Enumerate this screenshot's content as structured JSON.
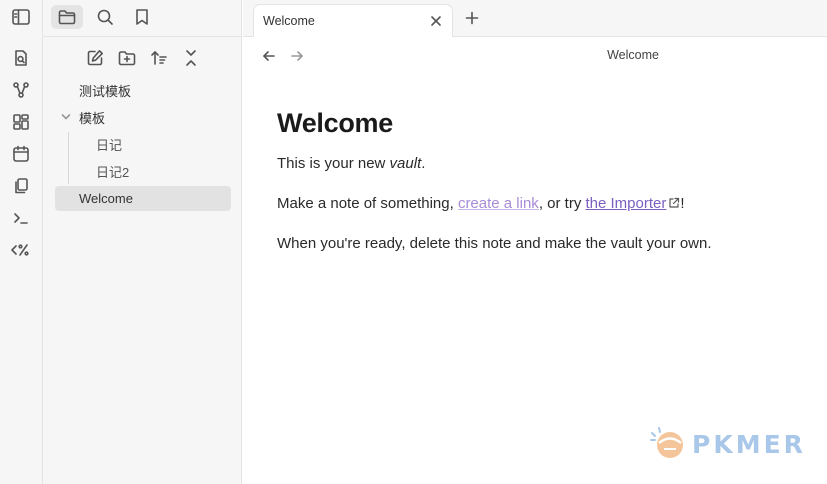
{
  "colors": {
    "ribbon_bg": "#f6f6f6",
    "active_tab_bg": "#e4e4e4",
    "link_internal": "#a88bd6",
    "link_external": "#7a5fc0",
    "watermark": "#a9c7e8"
  },
  "ribbon": {
    "icons": [
      "sidebar-toggle-icon",
      "quick-switcher-icon",
      "graph-view-icon",
      "canvas-icon",
      "daily-note-icon",
      "templates-icon",
      "command-palette-icon",
      "templater-icon"
    ]
  },
  "sidebar": {
    "tabs": [
      "folder-icon",
      "search-icon",
      "bookmark-icon"
    ],
    "actions": [
      "new-note-icon",
      "new-folder-icon",
      "sort-icon",
      "collapse-all-icon"
    ],
    "tree": [
      {
        "label": "测试模板",
        "type": "file"
      },
      {
        "label": "模板",
        "type": "folder",
        "expanded": true
      },
      {
        "label": "日记",
        "type": "file",
        "parent": "模板"
      },
      {
        "label": "日记2",
        "type": "file",
        "parent": "模板"
      },
      {
        "label": "Welcome",
        "type": "file",
        "selected": true
      }
    ]
  },
  "tabbar": {
    "tabs": [
      {
        "title": "Welcome",
        "active": true
      }
    ]
  },
  "view": {
    "title": "Welcome"
  },
  "note": {
    "heading": "Welcome",
    "p1_before": "This is your new ",
    "p1_em": "vault",
    "p1_after": ".",
    "p2_before": "Make a note of something, ",
    "p2_link": "create a link",
    "p2_mid": ", or try ",
    "p2_ext_link": "the Importer",
    "p2_after": "!",
    "p3": "When you're ready, delete this note and make the vault your own."
  },
  "watermark": {
    "text": "PKMER"
  }
}
